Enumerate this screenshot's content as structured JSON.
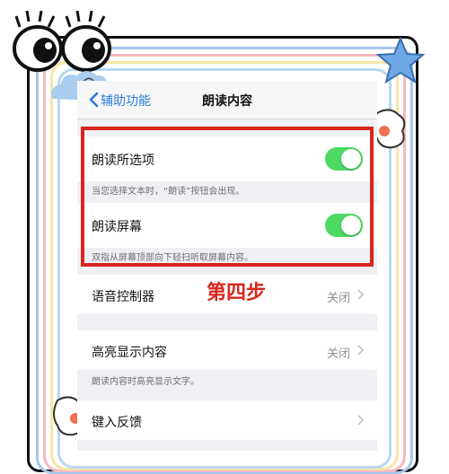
{
  "navbar": {
    "back_label": "辅助功能",
    "title": "朗读内容"
  },
  "settings": {
    "speak_selection": {
      "label": "朗读所选项",
      "enabled": true,
      "footnote": "当您选择文本时，“朗读”按钮会出现。"
    },
    "speak_screen": {
      "label": "朗读屏幕",
      "enabled": true,
      "footnote": "双指从屏幕顶部向下轻扫听取屏幕内容。"
    },
    "speech_controller": {
      "label": "语音控制器",
      "value": "关闭"
    },
    "highlight_content": {
      "label": "高亮显示内容",
      "value": "关闭",
      "footnote": "朗读内容时高亮显示文字。"
    },
    "typing_feedback": {
      "label": "键入反馈"
    }
  },
  "annotation": {
    "text": "第四步",
    "color": "#d8261c"
  },
  "colors": {
    "toggle_on": "#4cd964",
    "link_blue": "#2d7bd8",
    "highlight_red": "#d8261c"
  },
  "icons": [
    "chevron-left-icon",
    "chevron-right-icon",
    "star-icon",
    "cartoon-eyes-icon"
  ]
}
